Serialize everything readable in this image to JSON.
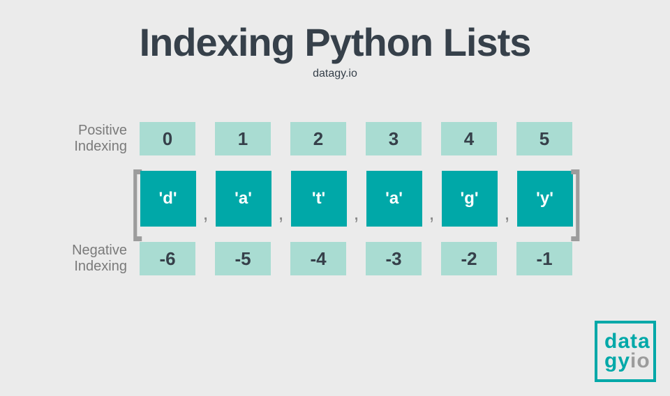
{
  "title": "Indexing Python Lists",
  "subtitle": "datagy.io",
  "positive_label": "Positive\nIndexing",
  "negative_label": "Negative\nIndexing",
  "positive_indices": [
    "0",
    "1",
    "2",
    "3",
    "4",
    "5"
  ],
  "list_items": [
    "'d'",
    "'a'",
    "'t'",
    "'a'",
    "'g'",
    "'y'"
  ],
  "negative_indices": [
    "-6",
    "-5",
    "-4",
    "-3",
    "-2",
    "-1"
  ],
  "bracket_left": "[",
  "bracket_right": "]",
  "comma": ",",
  "logo": {
    "line1": "data",
    "line2a": "gy",
    "line2b": "io"
  },
  "colors": {
    "accent": "#00a8a8",
    "light": "#a9dcd2",
    "dark": "#36404a",
    "bg": "#ebebeb"
  }
}
